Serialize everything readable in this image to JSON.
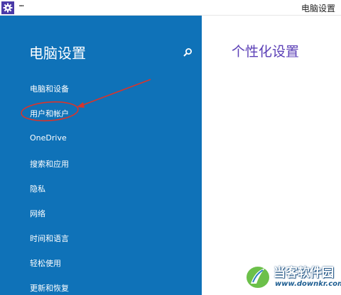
{
  "window": {
    "title": "电脑设置",
    "menu_glyph": "┅",
    "icon": "gear-icon"
  },
  "sidebar": {
    "title": "电脑设置",
    "search_icon": "search-icon",
    "items": [
      {
        "label": "电脑和设备"
      },
      {
        "label": "用户和帐户",
        "highlighted": true
      },
      {
        "label": "OneDrive"
      },
      {
        "label": "搜索和应用"
      },
      {
        "label": "隐私"
      },
      {
        "label": "网络"
      },
      {
        "label": "时间和语言"
      },
      {
        "label": "轻松使用"
      },
      {
        "label": "更新和恢复"
      }
    ]
  },
  "main": {
    "title": "个性化设置"
  },
  "watermark": {
    "name": "当客软件园",
    "url": "www.downkr.com"
  },
  "colors": {
    "sidebar_bg": "#0f72b8",
    "accent_title": "#5b3fb6",
    "annotation": "#d9342b",
    "app_icon_bg": "#4a3aa8"
  }
}
